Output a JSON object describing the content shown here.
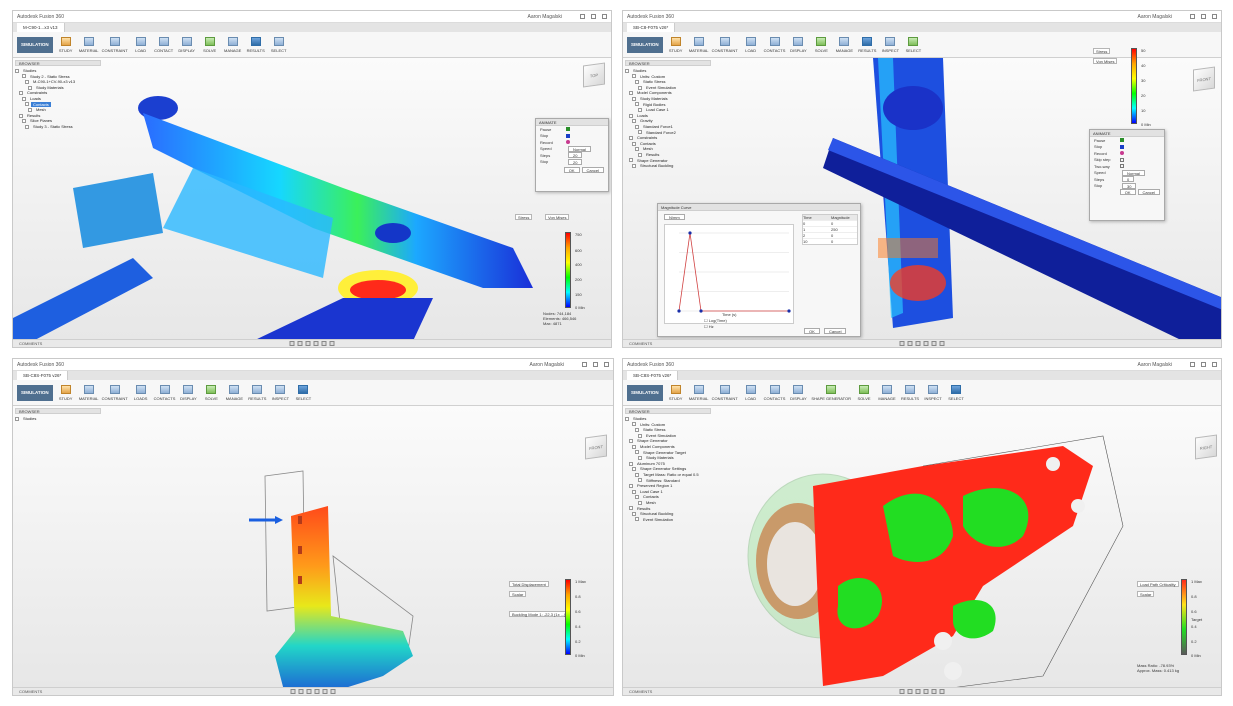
{
  "panes": [
    {
      "window_title": "Autodesk Fusion 360",
      "tab": "M-C90-1...x3 v13",
      "user": "Aaron Magalski",
      "workspace": "SIMULATION",
      "toolbar": [
        "STUDY",
        "MATERIAL",
        "CONSTRAINT",
        "LOAD",
        "CONTACT",
        "DISPLAY",
        "SOLVE",
        "MANAGE",
        "RESULTS",
        "SELECT"
      ],
      "browser_header": "BROWSER",
      "browser": [
        {
          "label": "Studies",
          "hl": false
        },
        {
          "label": "Study 2 - Static Stress",
          "hl": false
        },
        {
          "label": "M-C90-1+CV-90-x3 v13",
          "hl": false
        },
        {
          "label": "Study Materials",
          "hl": false
        },
        {
          "label": "Constraints",
          "hl": false
        },
        {
          "label": "Loads",
          "hl": false
        },
        {
          "label": "Contacts",
          "hl": true
        },
        {
          "label": "Mesh",
          "hl": false
        },
        {
          "label": "Results",
          "hl": false
        },
        {
          "label": "Slice Planes",
          "hl": false
        },
        {
          "label": "Study 3 - Static Stress",
          "hl": false
        }
      ],
      "animate": {
        "title": "ANIMATE",
        "rows": [
          {
            "k": "Pause",
            "v": ""
          },
          {
            "k": "Stop",
            "v": ""
          },
          {
            "k": "Record",
            "v": ""
          },
          {
            "k": "Speed",
            "v": "Normal"
          },
          {
            "k": "Steps",
            "v": "20"
          },
          {
            "k": "Stop",
            "v": "20"
          }
        ],
        "ok": "OK",
        "cancel": "Cancel"
      },
      "legend_dropdown": "Stress",
      "legend_dropdown2": "Von Mises",
      "legend_ticks": [
        "750",
        "600",
        "400",
        "200",
        "150",
        "0 Min"
      ],
      "stats": [
        {
          "k": "Nodes:",
          "v": "744,184"
        },
        {
          "k": "Elements:",
          "v": "466,546"
        },
        {
          "k": "Max:",
          "v": "4871"
        }
      ],
      "status": "COMMENTS"
    },
    {
      "window_title": "Autodesk Fusion 360",
      "tab": "SB-C8-F075 v26*",
      "user": "Aaron Magalski",
      "workspace": "SIMULATION",
      "toolbar": [
        "STUDY",
        "MATERIAL",
        "CONSTRAINT",
        "LOAD",
        "CONTACTS",
        "DISPLAY",
        "SOLVE",
        "MANAGE",
        "RESULTS",
        "INSPECT",
        "SELECT"
      ],
      "browser_header": "BROWSER",
      "browser": [
        {
          "label": "Studies",
          "hl": false
        },
        {
          "label": "Units: Custom",
          "hl": false
        },
        {
          "label": "Static Stress",
          "hl": false
        },
        {
          "label": "Event Simulation",
          "hl": false
        },
        {
          "label": "Model Components",
          "hl": false
        },
        {
          "label": "Study Materials",
          "hl": false
        },
        {
          "label": "Rigid Bodies",
          "hl": false
        },
        {
          "label": "Load Case 1",
          "hl": false
        },
        {
          "label": "Loads",
          "hl": false
        },
        {
          "label": "Gravity",
          "hl": false
        },
        {
          "label": "Standard Force1",
          "hl": false
        },
        {
          "label": "Standard Force2",
          "hl": false
        },
        {
          "label": "Constraints",
          "hl": false
        },
        {
          "label": "Contacts",
          "hl": false
        },
        {
          "label": "Mesh",
          "hl": false
        },
        {
          "label": "Results",
          "hl": false
        },
        {
          "label": "Shape Generator",
          "hl": false
        },
        {
          "label": "Structural Buckling",
          "hl": false
        }
      ],
      "curve": {
        "title": "Magnitude Curve",
        "unit": "N/mm",
        "time_label": "Time (s)",
        "check1": "Log(Time)",
        "check2": "Hz",
        "table_headers": [
          "Time",
          "Magnitude"
        ],
        "table_rows": [
          [
            "0",
            "0"
          ],
          [
            "1",
            "250"
          ],
          [
            "2",
            "0"
          ],
          [
            "10",
            "0"
          ]
        ],
        "ok": "OK",
        "cancel": "Cancel",
        "x": [
          0,
          1,
          2,
          10
        ],
        "y": [
          0,
          250,
          0,
          0
        ]
      },
      "legend_dropdown": "Stress",
      "legend_dropdown2": "Von Mises",
      "legend_ticks": [
        "50",
        "40",
        "30",
        "20",
        "10",
        "0 Min"
      ],
      "animate": {
        "title": "ANIMATE",
        "rows": [
          {
            "k": "Pause",
            "v": ""
          },
          {
            "k": "Stop",
            "v": ""
          },
          {
            "k": "Record",
            "v": ""
          },
          {
            "k": "Skip step",
            "v": ""
          },
          {
            "k": "Two-way",
            "v": ""
          },
          {
            "k": "Speed",
            "v": "Normal"
          },
          {
            "k": "Steps",
            "v": "0"
          },
          {
            "k": "Stop",
            "v": "30"
          }
        ],
        "ok": "OK",
        "cancel": "Cancel"
      },
      "status": "COMMENTS"
    },
    {
      "window_title": "Autodesk Fusion 360",
      "tab": "SB-C8S-F075 v26*",
      "user": "Aaron Magalski",
      "workspace": "SIMULATION",
      "toolbar": [
        "STUDY",
        "MATERIAL",
        "CONSTRAINT",
        "LOADS",
        "CONTACTS",
        "DISPLAY",
        "SOLVE",
        "MANAGE",
        "RESULTS",
        "INSPECT",
        "SELECT"
      ],
      "browser_header": "BROWSER",
      "browser": [
        {
          "label": "Studies",
          "hl": false
        }
      ],
      "legend_dropdown": "Total Displacement",
      "legend_dropdown2": "Scalar",
      "legend_dropdown3": "Buckling Mode 1: -22.3 (1x ...)",
      "legend_ticks": [
        "1 Max",
        "0.8",
        "0.6",
        "0.4",
        "0.2",
        "0 Min"
      ],
      "status": "COMMENTS"
    },
    {
      "window_title": "Autodesk Fusion 360",
      "tab": "SB-C8S-F075 v26*",
      "user": "Aaron Magalski",
      "workspace": "SIMULATION",
      "toolbar": [
        "STUDY",
        "MATERIAL",
        "CONSTRAINT",
        "LOAD",
        "CONTACTS",
        "DISPLAY",
        "SHAPE GENERATOR",
        "SOLVE",
        "MANAGE",
        "RESULTS",
        "INSPECT",
        "SELECT"
      ],
      "browser_header": "BROWSER",
      "browser": [
        {
          "label": "Studies",
          "hl": false
        },
        {
          "label": "Units: Custom",
          "hl": false
        },
        {
          "label": "Static Stress",
          "hl": false
        },
        {
          "label": "Event Simulation",
          "hl": false
        },
        {
          "label": "Shape Generator",
          "hl": false
        },
        {
          "label": "Model Components",
          "hl": false
        },
        {
          "label": "Shape Generator Target",
          "hl": false
        },
        {
          "label": "Study Materials",
          "hl": false
        },
        {
          "label": "Aluminum 7075",
          "hl": false
        },
        {
          "label": "Shape Generator Settings",
          "hl": false
        },
        {
          "label": "Target Mass: Ratio or equal 0.5",
          "hl": false
        },
        {
          "label": "Stiffness: Standard",
          "hl": false
        },
        {
          "label": "Preserved Region 1",
          "hl": false
        },
        {
          "label": "Load Case 1",
          "hl": false
        },
        {
          "label": "Contacts",
          "hl": false
        },
        {
          "label": "Mesh",
          "hl": false
        },
        {
          "label": "Results",
          "hl": false
        },
        {
          "label": "Structural Buckling",
          "hl": false
        },
        {
          "label": "Event Simulation",
          "hl": false
        }
      ],
      "legend_dropdown": "Load Path Criticality",
      "legend_dropdown2": "Scalar",
      "legend_ticks": [
        "1 Max",
        "0.8",
        "0.6",
        "0.4",
        "0.2",
        "0 Min"
      ],
      "target": "Target",
      "stats": [
        {
          "k": "Mass Ratio:",
          "v": "-78.93%"
        },
        {
          "k": "Approx. Mass:",
          "v": "0.413 kg"
        }
      ],
      "status": "COMMENTS"
    }
  ],
  "colors": {
    "workspace_button": "#4f6f8f",
    "browser_highlight": "#3a7fd6",
    "fea_red": "#ff2a1a",
    "fea_green": "#22dd22",
    "fea_blue": "#1a2fd8"
  }
}
